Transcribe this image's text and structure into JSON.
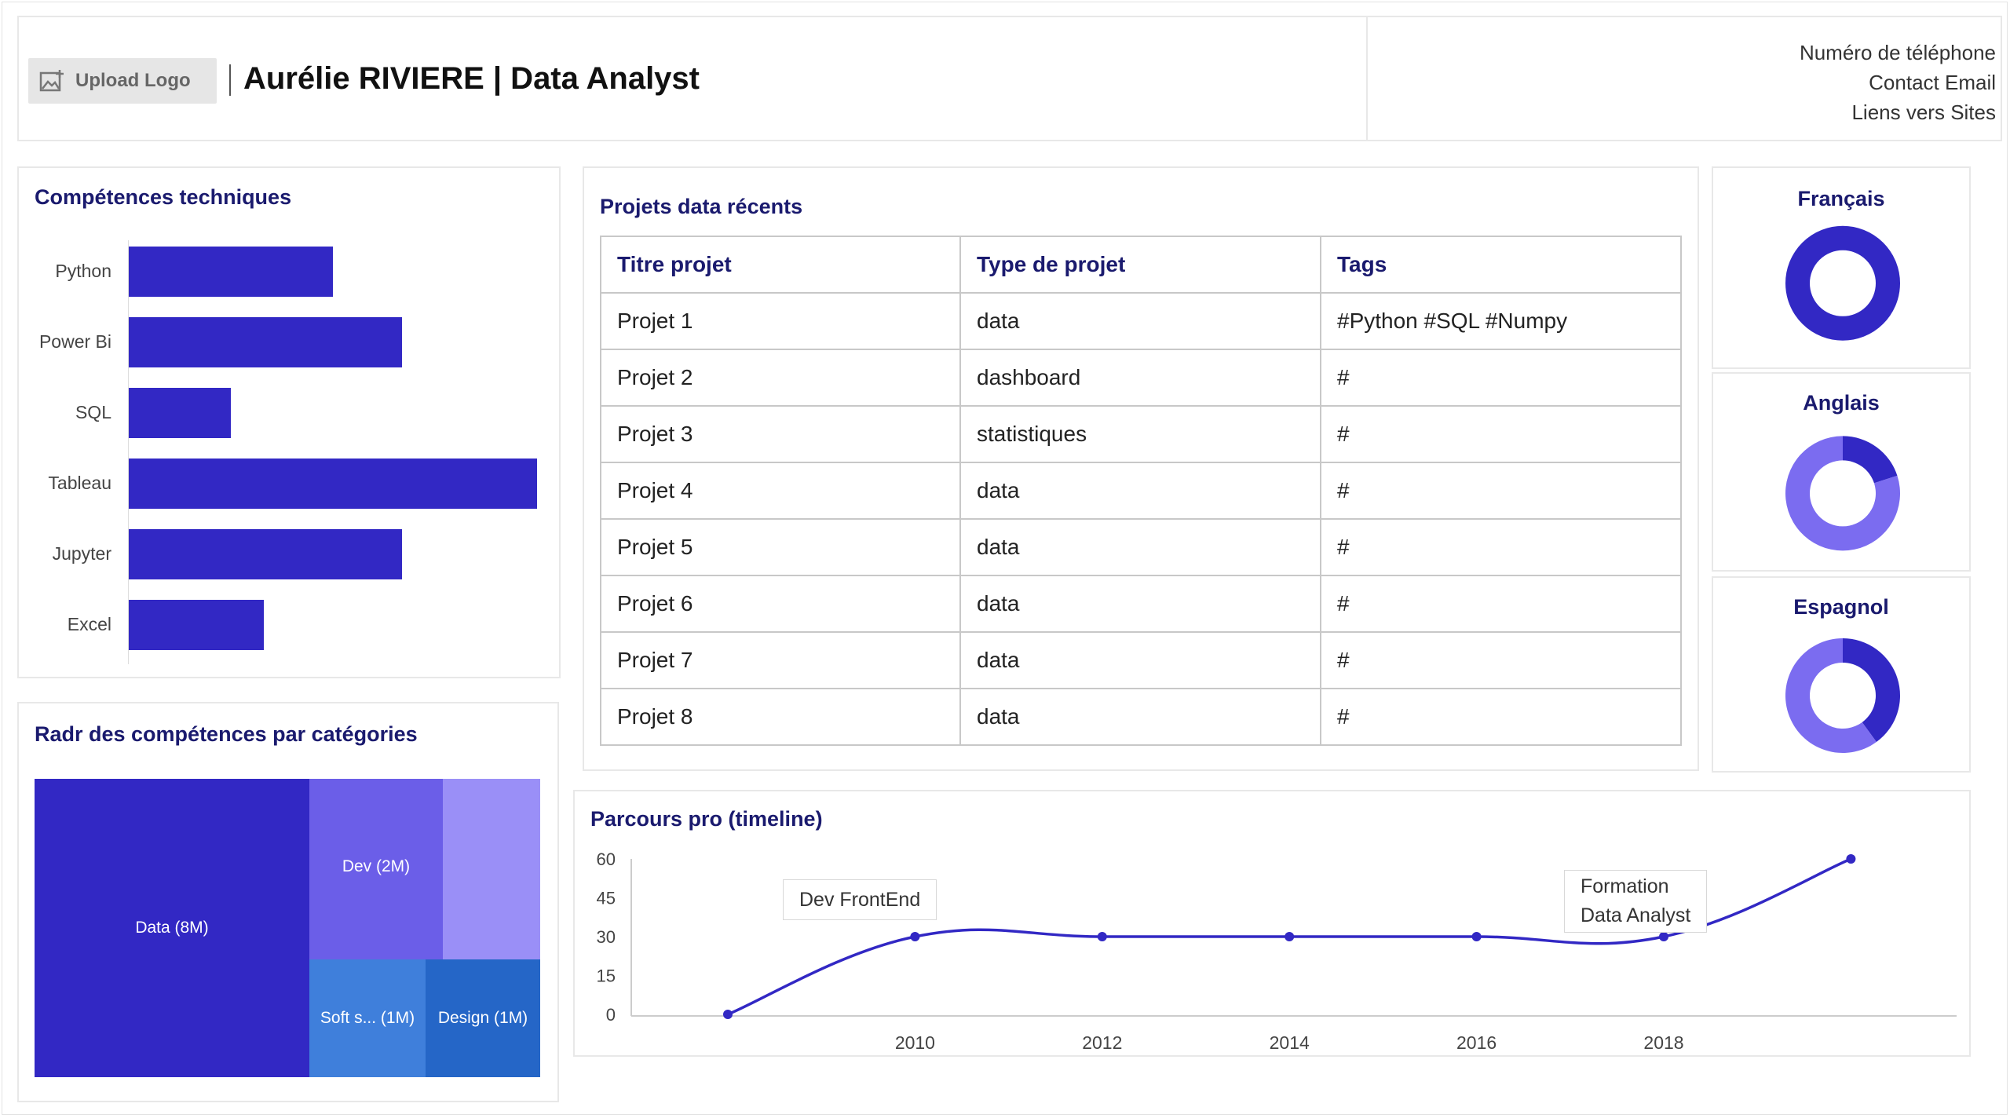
{
  "header": {
    "upload_label": "Upload Logo",
    "name_title": "Aurélie RIVIERE | Data Analyst",
    "contact": [
      "Numéro de téléphone",
      "Contact Email",
      "Liens vers Sites"
    ]
  },
  "skills": {
    "title": "Compétences techniques",
    "chart_data": {
      "type": "bar",
      "orientation": "horizontal",
      "categories": [
        "Python",
        "Power Bi",
        "SQL",
        "Tableau",
        "Jupyter",
        "Excel"
      ],
      "values": [
        5,
        6.7,
        2.5,
        10,
        6.7,
        3.3
      ],
      "grid": false
    }
  },
  "radar": {
    "title": "Radr des compétences par catégories",
    "chart_data": {
      "type": "treemap",
      "items": [
        {
          "label": "Data (8M)",
          "value": 8,
          "color": "#3228c4"
        },
        {
          "label": "Dev (2M)",
          "value": 2,
          "color": "#6b5ee8"
        },
        {
          "label": "",
          "value": 2,
          "color": "#9a8ff7"
        },
        {
          "label": "Soft s... (1M)",
          "value": 1,
          "color": "#3f7fdb"
        },
        {
          "label": "Design (1M)",
          "value": 1,
          "color": "#2566c7"
        }
      ]
    }
  },
  "projects": {
    "title": "Projets data récents",
    "columns": [
      "Titre projet",
      "Type de projet",
      "Tags"
    ],
    "rows": [
      [
        "Projet 1",
        "data",
        "#Python #SQL #Numpy"
      ],
      [
        "Projet 2",
        "dashboard",
        "#"
      ],
      [
        "Projet 3",
        "statistiques",
        "#"
      ],
      [
        "Projet 4",
        "data",
        "#"
      ],
      [
        "Projet 5",
        "data",
        "#"
      ],
      [
        "Projet 6",
        "data",
        "#"
      ],
      [
        "Projet 7",
        "data",
        "#"
      ],
      [
        "Projet 8",
        "data",
        "#"
      ]
    ]
  },
  "languages": {
    "chart_data": [
      {
        "type": "pie",
        "title": "Français",
        "values": [
          100,
          0
        ],
        "colors": [
          "#3228c4",
          "#7b6cf0"
        ]
      },
      {
        "type": "pie",
        "title": "Anglais",
        "values": [
          20,
          80
        ],
        "colors": [
          "#3228c4",
          "#7b6cf0"
        ]
      },
      {
        "type": "pie",
        "title": "Espagnol",
        "values": [
          40,
          60
        ],
        "colors": [
          "#3228c4",
          "#7b6cf0"
        ]
      }
    ]
  },
  "timeline": {
    "title": "Parcours pro (timeline)",
    "chart_data": {
      "type": "line",
      "x": [
        2008,
        2010,
        2012,
        2014,
        2016,
        2018,
        2020
      ],
      "y": [
        0,
        30,
        30,
        30,
        30,
        30,
        60
      ],
      "ylim": [
        0,
        60
      ],
      "yticks": [
        60,
        45,
        30,
        15,
        0
      ],
      "xticks": [
        2010,
        2012,
        2014,
        2016,
        2018
      ],
      "annotations": [
        "Dev FrontEnd",
        "Formation\nData Analyst"
      ],
      "color": "#3228c4"
    }
  }
}
